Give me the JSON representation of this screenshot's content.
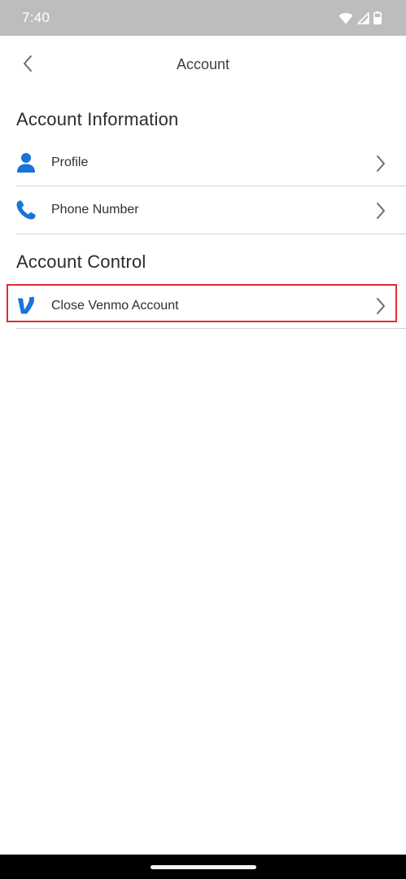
{
  "status_bar": {
    "time": "7:40",
    "icons": [
      "wifi-icon",
      "cell-signal-icon",
      "battery-icon"
    ]
  },
  "header": {
    "title": "Account",
    "back_icon": "chevron-left-icon"
  },
  "sections": [
    {
      "heading": "Account Information",
      "items": [
        {
          "label": "Profile",
          "icon": "person-icon"
        },
        {
          "label": "Phone Number",
          "icon": "phone-icon"
        }
      ]
    },
    {
      "heading": "Account Control",
      "items": [
        {
          "label": "Close Venmo Account",
          "icon": "venmo-logo-icon",
          "highlighted": true
        }
      ]
    }
  ],
  "colors": {
    "accent_blue": "#1a73d9",
    "status_bar": "#bdbdbd",
    "highlight_border": "#e02b35",
    "divider": "#cfd1d4"
  }
}
